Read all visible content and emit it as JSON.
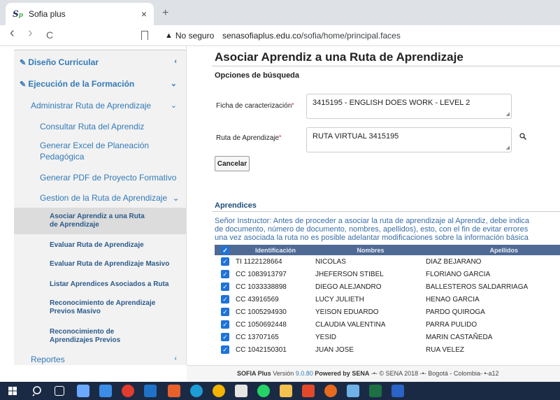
{
  "browser": {
    "tab_title": "Sofia plus",
    "favicon_s": "S",
    "favicon_p": "p",
    "tab_close": "×",
    "new_tab": "+",
    "back": "‹",
    "forward": "›",
    "reload": "C",
    "security_warning": "No seguro",
    "url_host": "senasofiaplus.edu.co",
    "url_path": "/sofia/home/principal.faces"
  },
  "sidebar": {
    "diseno": "Diseño Curricular",
    "ejecucion": "Ejecución de la Formación",
    "administrar": "Administrar Ruta de Aprendizaje",
    "consultar": "Consultar Ruta del Aprendiz",
    "generar_excel": "Generar Excel de Planeación Pedagógica",
    "generar_pdf": "Generar PDF de Proyecto Formativo",
    "gestion": "Gestion de la Ruta de Aprendizaje",
    "asociar": "Asociar Aprendiz a una Ruta de Aprendizaje",
    "evaluar": "Evaluar Ruta de Aprendizaje",
    "evaluar_masivo": "Evaluar Ruta de Aprendizaje Masivo",
    "listar": "Listar Aprendices Asociados a Ruta",
    "reconocimiento_masivo": "Reconocimiento de Aprendizaje Previos Masivo",
    "reconocimiento": "Reconocimiento de Aprendizajes Previos",
    "reportes": "Reportes"
  },
  "main": {
    "title": "Asociar Aprendiz a una Ruta de Aprendizaje",
    "opciones": "Opciones de búsqueda",
    "ficha_label": "Ficha de caracterización",
    "ficha_value": "3415195 - ENGLISH DOES WORK - LEVEL 2",
    "ruta_label": "Ruta de Aprendizaje",
    "ruta_value": "RUTA VIRTUAL 3415195",
    "required_mark": "*",
    "cancelar": "Cancelar",
    "aprendices_title": "Aprendices",
    "note_line1": "Señor Instructor: Antes de proceder a asociar la ruta de aprendizaje al Aprendiz, debe indica",
    "note_line2": "de documento, número de documento, nombres, apellidos), esto, con el fin de evitar errores",
    "note_line3": "una vez asociada la ruta no es posible adelantar modificaciones sobre la información básica"
  },
  "table": {
    "columns": [
      "Identificación",
      "Nombres",
      "Apellidos"
    ],
    "rows": [
      {
        "id": "TI 1122128664",
        "nombres": "NICOLAS",
        "apellidos": "DIAZ BEJARANO"
      },
      {
        "id": "CC 1083913797",
        "nombres": "JHEFERSON STIBEL",
        "apellidos": "FLORIANO GARCIA"
      },
      {
        "id": "CC 1033338898",
        "nombres": "DIEGO ALEJANDRO",
        "apellidos": "BALLESTEROS SALDARRIAGA"
      },
      {
        "id": "CC 43916569",
        "nombres": "LUCY JULIETH",
        "apellidos": "HENAO GARCIA"
      },
      {
        "id": "CC 1005294930",
        "nombres": "YEISON EDUARDO",
        "apellidos": "PARDO QUIROGA"
      },
      {
        "id": "CC 1050692448",
        "nombres": "CLAUDIA VALENTINA",
        "apellidos": "PARRA PULIDO"
      },
      {
        "id": "CC 13707165",
        "nombres": "YESID",
        "apellidos": "MARIN CASTAÑEDA"
      },
      {
        "id": "CC 1042150301",
        "nombres": "JUAN JOSE",
        "apellidos": "RUA VELEZ"
      }
    ],
    "checkmark": "✓"
  },
  "footer": {
    "app": "SOFIA Plus",
    "version_label": "Versión",
    "version": "9.0.80",
    "powered": "Powered by SENA",
    "rest": "-•- © SENA 2018 -•- Bogotá - Colombia- •-a12"
  },
  "colors": {
    "link": "#337ab7",
    "header": "#4f6a94",
    "checkbox": "#1e73d8",
    "taskbar": "#1b2a44"
  }
}
